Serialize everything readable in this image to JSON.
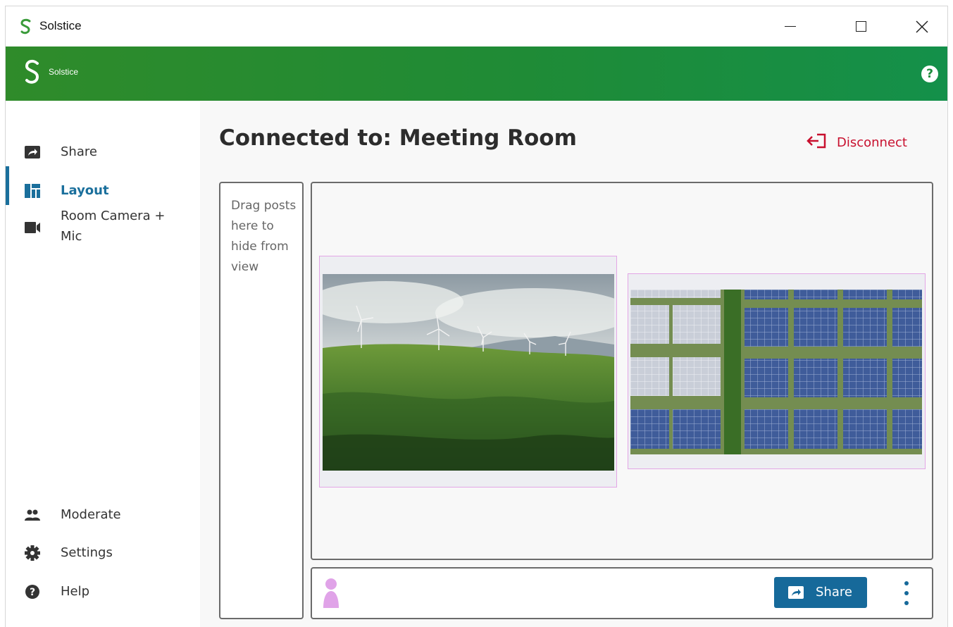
{
  "window": {
    "title": "Solstice",
    "controls": {
      "minimize": "minimize",
      "maximize": "maximize",
      "close": "close"
    }
  },
  "header": {
    "brand": "Solstice",
    "help_icon": "question-circle-icon",
    "help_glyph": "?",
    "colors": {
      "start": "#2f8b2a",
      "end": "#14904a"
    }
  },
  "sidebar": {
    "items": [
      {
        "label": "Share",
        "icon": "share-arrow-icon"
      },
      {
        "label": "Layout",
        "icon": "layout-grid-icon",
        "active": true
      },
      {
        "label": "Room Camera + Mic",
        "icon": "video-camera-icon"
      }
    ],
    "bottom_items": [
      {
        "label": "Moderate",
        "icon": "people-icon"
      },
      {
        "label": "Settings",
        "icon": "gear-icon"
      },
      {
        "label": "Help",
        "icon": "help-circle-icon"
      }
    ],
    "active_color": "#1a6f9c"
  },
  "main": {
    "title": "Connected to: Meeting Room",
    "disconnect_label": "Disconnect",
    "disconnect_color": "#c8102e",
    "hide_zone_text": "Drag posts here to hide from view",
    "posts": [
      {
        "type": "image",
        "subject": "wind-turbines-landscape"
      },
      {
        "type": "image",
        "subject": "solar-panels-aerial"
      }
    ],
    "bottom": {
      "avatar_color": "#e0a3e8",
      "share_label": "Share",
      "share_color": "#16699a"
    }
  }
}
